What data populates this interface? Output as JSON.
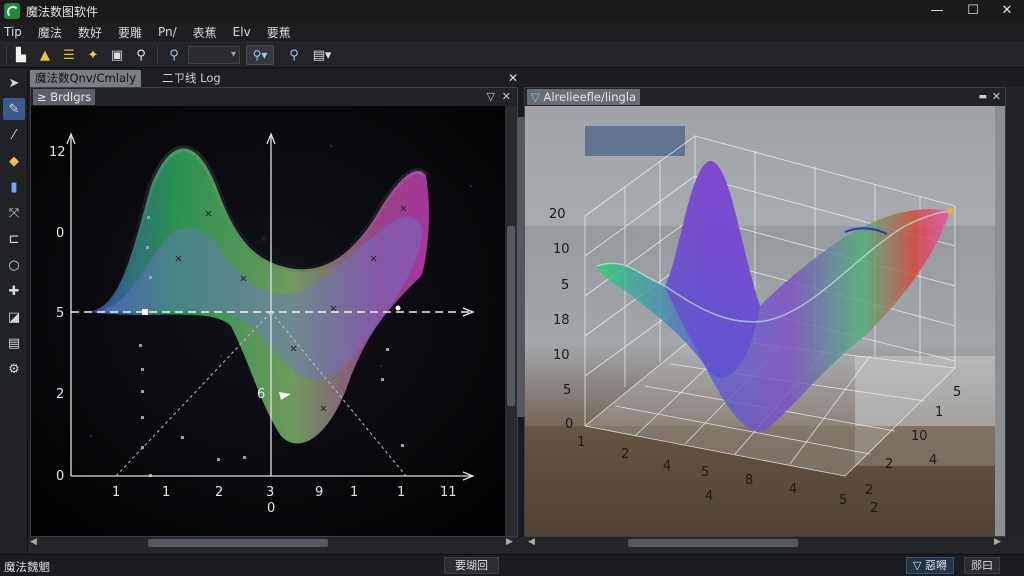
{
  "window": {
    "title": "魔法数图软件",
    "controls": {
      "minimize": "—",
      "maximize": "☐",
      "close": "✕"
    }
  },
  "menu": [
    "Tip",
    "魔法",
    "数好",
    "要雕",
    "Pn/",
    "表蕉",
    "Elv",
    "要蕉"
  ],
  "toolbar": {
    "buttons": [
      "new-icon",
      "open-icon",
      "layers-icon",
      "sparkle-icon",
      "save-icon",
      "zoom-icon"
    ],
    "combo_value": "",
    "dropdown_icons": [
      "zoom-in-icon",
      "magnet-icon",
      "search-icon",
      "export-icon"
    ]
  },
  "tool_rail": [
    "pointer-icon",
    "pen-icon",
    "pipette-icon",
    "fill-icon",
    "brush-icon",
    "transform-icon",
    "crop-icon",
    "lasso-icon",
    "pin-icon",
    "eraser-icon",
    "layers-icon",
    "settings-icon"
  ],
  "document_tabs": {
    "active": "魔法数Qnv/Cmlaly",
    "second": "二ㄗ线 Log"
  },
  "left_panel": {
    "label": "≥ Brdlgrs",
    "y_ticks": [
      "12",
      "0",
      "5",
      "2",
      "0"
    ],
    "x_ticks": [
      "1",
      "1",
      "2",
      "3",
      "9",
      "1",
      "1",
      "11"
    ],
    "origin_label": "0",
    "annotation": "6"
  },
  "right_panel": {
    "label": "Alrelieefle/lingla",
    "z_ticks": [
      "20",
      "10",
      "5",
      "18",
      "10",
      "5",
      "0"
    ],
    "front_ticks": [
      "1",
      "2",
      "4",
      "5",
      "8",
      "4",
      "5"
    ],
    "front_sub_tick": "4",
    "depth_ticks": [
      "5",
      "1",
      "10",
      "2",
      "2"
    ],
    "depth_extra_ticks": [
      "4",
      "2"
    ]
  },
  "status": {
    "left": "魔法魏魍",
    "mid": "要瑚回",
    "right1": "惡嘚",
    "right2": "郧曰"
  },
  "colors": {
    "accent": "#3a5a8a",
    "surface_green": "#2fa85a",
    "surface_blue": "#3f57c8",
    "surface_magenta": "#c23fb0",
    "surface_orange": "#e0902a"
  }
}
